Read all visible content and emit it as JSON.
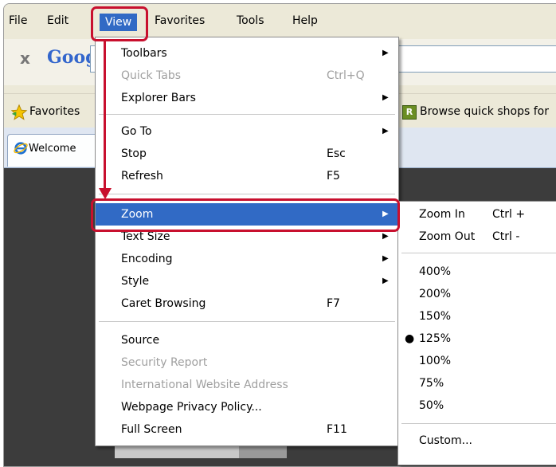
{
  "menubar": {
    "items": [
      "File",
      "Edit",
      "View",
      "Favorites",
      "Tools",
      "Help"
    ]
  },
  "address": {
    "close": "x",
    "brand": "Goog"
  },
  "favorites_bar": {
    "label": "Favorites",
    "browse": "Browse quick shops for",
    "browse_icon_letter": "R"
  },
  "tab": {
    "label": "Welcome"
  },
  "view_menu": {
    "toolbars": "Toolbars",
    "quick_tabs": "Quick Tabs",
    "quick_tabs_sc": "Ctrl+Q",
    "explorer_bars": "Explorer Bars",
    "go_to": "Go To",
    "stop": "Stop",
    "stop_sc": "Esc",
    "refresh": "Refresh",
    "refresh_sc": "F5",
    "zoom": "Zoom",
    "text_size": "Text Size",
    "encoding": "Encoding",
    "style": "Style",
    "caret": "Caret Browsing",
    "caret_sc": "F7",
    "source": "Source",
    "security": "Security Report",
    "intl": "International Website Address",
    "privacy": "Webpage Privacy Policy...",
    "fullscreen": "Full Screen",
    "fullscreen_sc": "F11"
  },
  "zoom_submenu": {
    "zoom_in": "Zoom In",
    "zoom_in_sc": "Ctrl +",
    "zoom_out": "Zoom Out",
    "zoom_out_sc": "Ctrl -",
    "levels": [
      "400%",
      "200%",
      "150%",
      "125%",
      "100%",
      "75%",
      "50%"
    ],
    "selected": "125%",
    "custom": "Custom..."
  },
  "colors": {
    "highlight": "#316ac5",
    "annotation": "#c8102e"
  }
}
